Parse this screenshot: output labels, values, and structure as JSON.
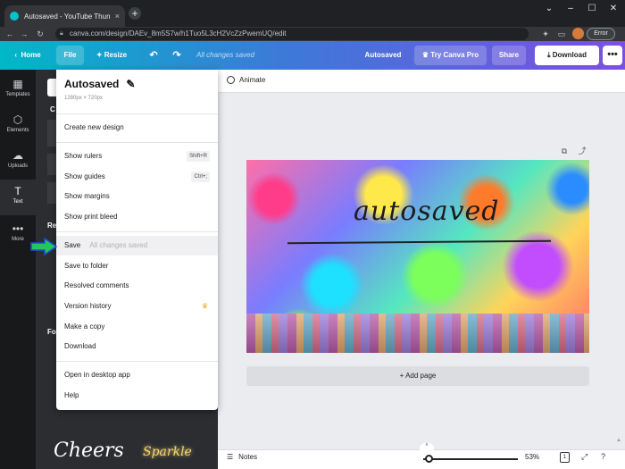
{
  "browser": {
    "tab_title": "Autosaved - YouTube Thumbnail",
    "tab_close": "×",
    "new_tab": "+",
    "url": "canva.com/design/DAEv_8m5S7w/h1Tuo5L3cH2VcZzPwemUQ/edit",
    "profile_button": "Error",
    "window_controls": [
      "⌄",
      "–",
      "☐",
      "✕"
    ]
  },
  "header": {
    "home": "Home",
    "file": "File",
    "resize": "Resize",
    "status": "All changes saved",
    "doc_title": "Autosaved",
    "try_canva_pro": "Try Canva Pro",
    "share": "Share",
    "download": "Download",
    "more": "•••"
  },
  "rail": {
    "items": [
      {
        "label": "Templates",
        "icon": "▦"
      },
      {
        "label": "Elements",
        "icon": "⬡"
      },
      {
        "label": "Uploads",
        "icon": "☁"
      },
      {
        "label": "Text",
        "icon": "T"
      },
      {
        "label": "More",
        "icon": "•••"
      }
    ]
  },
  "panel": {
    "fragment_1": "C",
    "fragment_2": "Re",
    "fragment_3": "Fo",
    "sample_1": "Cheers",
    "sample_2": "Sparkle",
    "collapse": "‹"
  },
  "editor": {
    "animate": "Animate",
    "canvas_text": "autosaved",
    "add_page": "+ Add page",
    "notes": "Notes",
    "zoom": "53%",
    "page_count": "1"
  },
  "menu": {
    "title": "Autosaved",
    "dimensions": "1280px × 720px",
    "create_new": "Create new design",
    "show_rulers": "Show rulers",
    "show_rulers_shortcut": "Shift+R",
    "show_guides": "Show guides",
    "show_guides_shortcut": "Ctrl+;",
    "show_margins": "Show margins",
    "show_print_bleed": "Show print bleed",
    "save": "Save",
    "save_status": "All changes saved",
    "save_to_folder": "Save to folder",
    "resolved_comments": "Resolved comments",
    "version_history": "Version history",
    "make_a_copy": "Make a copy",
    "download": "Download",
    "open_desktop": "Open in desktop app",
    "help": "Help"
  },
  "colors": {
    "header_start": "#00b8c8",
    "header_end": "#7d4fe0",
    "arrow": "#22c55e",
    "crown": "#f5a623"
  }
}
